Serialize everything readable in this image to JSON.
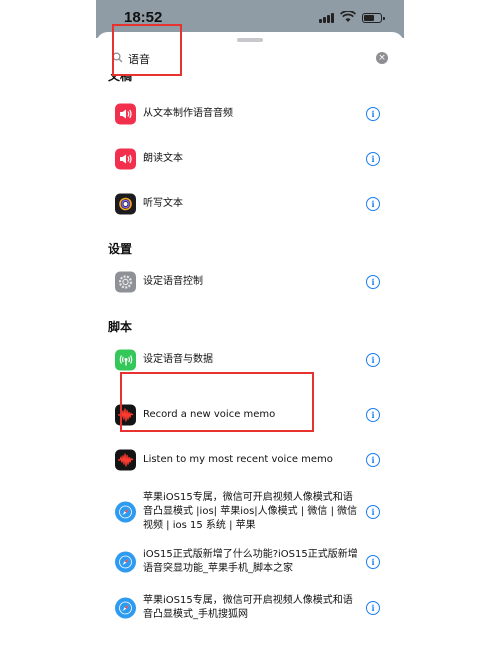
{
  "status_bar": {
    "time": "18:52"
  },
  "search": {
    "value": "语音",
    "placeholder": ""
  },
  "sections": {
    "documents": "文稿",
    "settings": "设置",
    "shortcuts": "脚本"
  },
  "items": [
    {
      "label": "从文本制作语音音频",
      "icon": "speaker-icon"
    },
    {
      "label": "朗读文本",
      "icon": "speaker-icon"
    },
    {
      "label": "听写文本",
      "icon": "dictation-icon"
    },
    {
      "label": "设定语音控制",
      "icon": "settings-gear-icon"
    },
    {
      "label": "设定语音与数据",
      "icon": "cellular-icon"
    },
    {
      "label": "Record a new voice memo",
      "icon": "voice-memo-icon"
    },
    {
      "label": "Listen to my most recent voice memo",
      "icon": "voice-memo-icon"
    },
    {
      "label": "苹果iOS15专属，微信可开启视频人像模式和语音凸显模式 |ios| 苹果ios|人像模式 | 微信 | 微信视频 | ios 15 系统 | 苹果",
      "icon": "safari-icon"
    },
    {
      "label": "iOS15正式版新增了什么功能?iOS15正式版新增语音突显功能_苹果手机_脚本之家",
      "icon": "safari-icon"
    },
    {
      "label": "苹果iOS15专属，微信可开启视频人像模式和语音凸显模式_手机搜狐网",
      "icon": "safari-icon"
    }
  ],
  "info_glyph": "i",
  "clear_glyph": "×",
  "colors": {
    "accent": "#1a7cf5",
    "annotation": "#e8322f"
  }
}
